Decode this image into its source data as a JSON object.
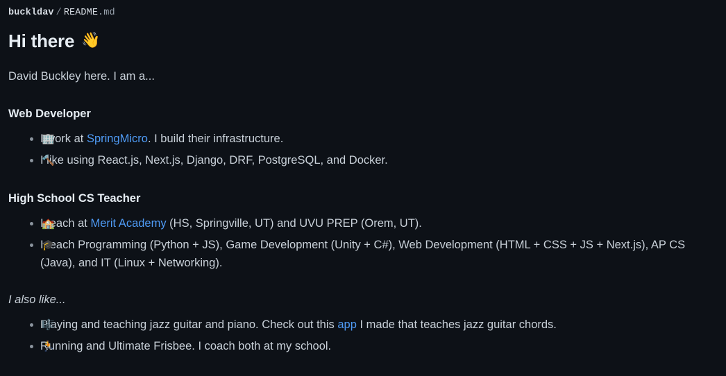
{
  "breadcrumb": {
    "owner": "buckldav",
    "separator": "/",
    "file_name": "README",
    "file_ext": ".md"
  },
  "readme": {
    "title": "Hi there",
    "title_emoji": "👋",
    "title_emoji_name": "waving-hand-icon",
    "intro": "David Buckley here. I am a...",
    "sections": [
      {
        "heading": "Web Developer",
        "items": [
          {
            "emoji": "🏢",
            "emoji_name": "office-building-icon",
            "parts": [
              {
                "type": "text",
                "text": "I work at "
              },
              {
                "type": "link",
                "text": "SpringMicro"
              },
              {
                "type": "text",
                "text": ". I build their infrastructure."
              }
            ]
          },
          {
            "emoji": "🔨",
            "emoji_name": "hammer-icon",
            "parts": [
              {
                "type": "text",
                "text": "I like using React.js, Next.js, Django, DRF, PostgreSQL, and Docker."
              }
            ]
          }
        ]
      },
      {
        "heading": "High School CS Teacher",
        "items": [
          {
            "emoji": "🏫",
            "emoji_name": "school-icon",
            "parts": [
              {
                "type": "text",
                "text": "I teach at "
              },
              {
                "type": "link",
                "text": "Merit Academy"
              },
              {
                "type": "text",
                "text": " (HS, Springville, UT) and UVU PREP (Orem, UT)."
              }
            ]
          },
          {
            "emoji": "🎓",
            "emoji_name": "graduation-cap-icon",
            "parts": [
              {
                "type": "text",
                "text": "I teach Programming (Python + JS), Game Development (Unity + C#), Web Development (HTML + CSS + JS + Next.js), AP CS (Java), and IT (Linux + Networking)."
              }
            ]
          }
        ]
      }
    ],
    "also_like_label": "I also like...",
    "also_like_items": [
      {
        "emoji": "🎼",
        "emoji_name": "musical-score-icon",
        "parts": [
          {
            "type": "text",
            "text": "Playing and teaching jazz guitar and piano. Check out this "
          },
          {
            "type": "link",
            "text": "app"
          },
          {
            "type": "text",
            "text": " I made that teaches jazz guitar chords."
          }
        ]
      },
      {
        "emoji": "🏃",
        "emoji_name": "runner-icon",
        "parts": [
          {
            "type": "text",
            "text": "Running and Ultimate Frisbee. I coach both at my school."
          }
        ]
      }
    ]
  },
  "colors": {
    "background": "#0d1117",
    "text": "#c9d1d9",
    "heading": "#e6edf3",
    "link": "#4f9bf5",
    "muted": "#8b949e"
  }
}
